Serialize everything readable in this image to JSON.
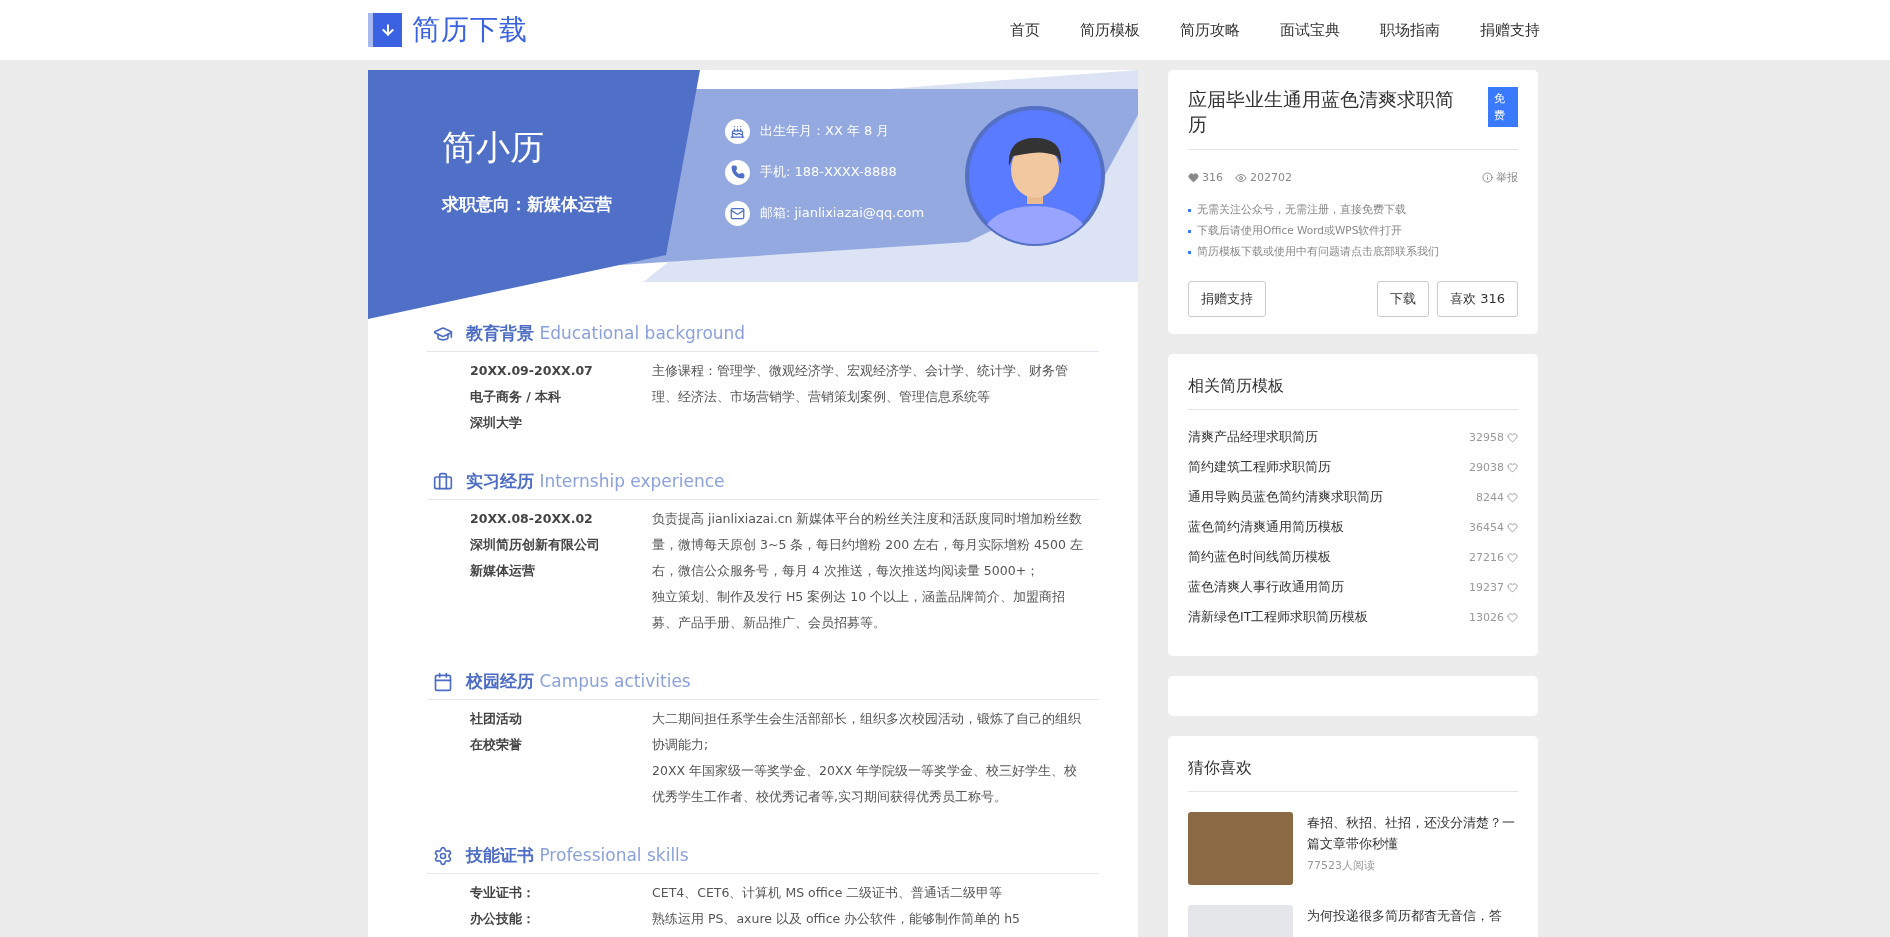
{
  "header": {
    "logo": "简历下载",
    "nav": [
      {
        "label": "首页"
      },
      {
        "label": "简历模板"
      },
      {
        "label": "简历攻略"
      },
      {
        "label": "面试宝典"
      },
      {
        "label": "职场指南"
      },
      {
        "label": "捐赠支持"
      }
    ]
  },
  "resume": {
    "name": "简小历",
    "objective": "求职意向：新媒体运营",
    "contacts": [
      {
        "kind": "birthday",
        "text": "出生年月：XX 年 8 月"
      },
      {
        "kind": "phone",
        "text": "手机: 188-XXXX-8888"
      },
      {
        "kind": "email",
        "text": "邮箱: jianlixiazai@qq.com"
      }
    ],
    "sections": [
      {
        "kind": "education",
        "title": "教育背景",
        "subtitle": "Educational background",
        "left": [
          "20XX.09-20XX.07",
          "电子商务 / 本科",
          "深圳大学"
        ],
        "right": [
          "主修课程：管理学、微观经济学、宏观经济学、会计学、统计学、财务管理、经济法、市场营销学、营销策划案例、管理信息系统等"
        ]
      },
      {
        "kind": "internship",
        "title": "实习经历",
        "subtitle": "Internship experience",
        "left": [
          "20XX.08-20XX.02",
          "深圳简历创新有限公司",
          "新媒体运营"
        ],
        "right": [
          "负责提高 jianlixiazai.cn 新媒体平台的粉丝关注度和活跃度同时增加粉丝数量，微博每天原创 3~5 条，每日约增粉 200 左右，每月实际增粉 4500 左右，微信公众服务号，每月 4 次推送，每次推送均阅读量 5000+；",
          "独立策划、制作及发行 H5 案例达 10 个以上，涵盖品牌简介、加盟商招募、产品手册、新品推广、会员招募等。"
        ]
      },
      {
        "kind": "campus",
        "title": "校园经历",
        "subtitle": "Campus activities",
        "left": [
          "社团活动",
          "在校荣誉"
        ],
        "right": [
          "大二期间担任系学生会生活部部长，组织多次校园活动，锻炼了自己的组织协调能力;",
          "20XX 年国家级一等奖学金、20XX 年学院级一等奖学金、校三好学生、校优秀学生工作者、校优秀记者等,实习期间获得优秀员工称号。"
        ]
      },
      {
        "kind": "skills",
        "title": "技能证书",
        "subtitle": "Professional skills",
        "left": [
          "专业证书：",
          "办公技能："
        ],
        "right": [
          "CET4、CET6、计算机 MS office 二级证书、普通话二级甲等",
          "熟练运用 PS、axure 以及 office 办公软件，能够制作简单的 h5"
        ]
      }
    ]
  },
  "detail": {
    "title": "应届毕业生通用蓝色清爽求职简历",
    "badge": "免费",
    "likes": "316",
    "views": "202702",
    "report": "举报",
    "notes": [
      "无需关注公众号，无需注册，直接免费下载",
      "下载后请使用Office Word或WPS软件打开",
      "简历模板下载或使用中有问题请点击底部联系我们"
    ],
    "donate": "捐赠支持",
    "download": "下载",
    "like": "喜欢 316"
  },
  "related": {
    "title": "相关简历模板",
    "items": [
      {
        "name": "清爽产品经理求职简历",
        "count": "32958"
      },
      {
        "name": "简约建筑工程师求职简历",
        "count": "29038"
      },
      {
        "name": "通用导购员蓝色简约清爽求职简历",
        "count": "8244"
      },
      {
        "name": "蓝色简约清爽通用简历模板",
        "count": "36454"
      },
      {
        "name": "简约蓝色时间线简历模板",
        "count": "27216"
      },
      {
        "name": "蓝色清爽人事行政通用简历",
        "count": "19237"
      },
      {
        "name": "清新绿色IT工程师求职简历模板",
        "count": "13026"
      }
    ]
  },
  "guess": {
    "title": "猜你喜欢",
    "articles": [
      {
        "title": "春招、秋招、社招，还没分清楚？一篇文章带你秒懂",
        "reads": "77523人阅读"
      },
      {
        "title": "为何投递很多简历都杳无音信，答"
      }
    ]
  }
}
